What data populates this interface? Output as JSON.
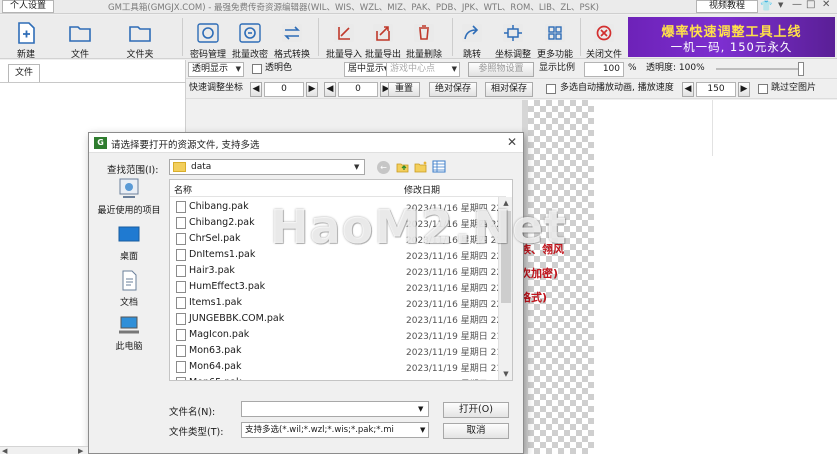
{
  "titlebar": {
    "personal_settings": "个人设置",
    "app_title": "GM工具箱(GMGJX.COM) - 最强免费传奇资源编辑器(WIL、WIS、WZL、MIZ、PAK、PDB、JPK、WTL、ROM、LIB、ZL、PSK)",
    "video_tutorial": "视频教程",
    "minimize": "—",
    "maximize": "□",
    "close": "✕"
  },
  "toolbar": {
    "new": "新建",
    "file": "文件",
    "folder": "文件夹",
    "password_mgmt": "密码管理",
    "batch_password": "批量改密",
    "format_convert": "格式转换",
    "batch_import": "批量导入",
    "batch_export": "批量导出",
    "batch_delete": "批量删除",
    "jump": "跳转",
    "coord_adjust": "坐标调整",
    "more": "更多功能",
    "close_file": "关闭文件"
  },
  "banner": {
    "line1": "爆率快速调整工具上线",
    "line2": "一机一码, 150元永久"
  },
  "left_panel": {
    "tab_file": "文件"
  },
  "options_row1": {
    "transparency_mode": "透明显示",
    "transparent_color": "透明色",
    "center_display": "居中显示",
    "center_point": "游戏中心点",
    "reference_setting": "参照物设置",
    "display_ratio_label": "显示比例",
    "display_ratio_value": "100",
    "percent": "%",
    "opacity_label": "透明度: 100%",
    "opacity_value": 1.0
  },
  "options_row2": {
    "quick_coord_label": "快速调整坐标",
    "x_value": "0",
    "y_value": "0",
    "reset": "重置",
    "absolute_save": "绝对保存",
    "relative_save": "相对保存",
    "multi_select_autoplay": "多选自动播放动画, 播放速度",
    "speed_value": "150",
    "skip_empty": "跳过空图片"
  },
  "background_text": {
    "line1": "族、翎风",
    "line2": "次加密)",
    "line3": "格式)"
  },
  "watermark": "HaoM2.Net",
  "dialog": {
    "title": "请选择要打开的资源文件, 支持多选",
    "look_in_label": "查找范围(I):",
    "look_in_value": "data",
    "places": [
      "最近使用的项目",
      "桌面",
      "文档",
      "此电脑"
    ],
    "columns": {
      "name": "名称",
      "date": "修改日期"
    },
    "files": [
      {
        "name": "Chibang.pak",
        "date": "2023/11/16 星期四 22"
      },
      {
        "name": "Chibang2.pak",
        "date": "2023/11/16 星期四 22"
      },
      {
        "name": "ChrSel.pak",
        "date": "2023/11/16 星期四 22"
      },
      {
        "name": "DnItems1.pak",
        "date": "2023/11/16 星期四 22"
      },
      {
        "name": "Hair3.pak",
        "date": "2023/11/16 星期四 22"
      },
      {
        "name": "HumEffect3.pak",
        "date": "2023/11/16 星期四 22"
      },
      {
        "name": "Items1.pak",
        "date": "2023/11/16 星期四 22"
      },
      {
        "name": "JUNGEBBK.COM.pak",
        "date": "2023/11/16 星期四 22"
      },
      {
        "name": "MagIcon.pak",
        "date": "2023/11/19 星期日 21"
      },
      {
        "name": "Mon63.pak",
        "date": "2023/11/19 星期日 21"
      },
      {
        "name": "Mon64.pak",
        "date": "2023/11/19 星期日 21"
      },
      {
        "name": "Mon65.pak",
        "date": "2023/11/19 星期日 21"
      }
    ],
    "filename_label": "文件名(N):",
    "filename_value": "",
    "filetype_label": "文件类型(T):",
    "filetype_value": "支持多选(*.wil;*.wzl;*.wis;*.pak;*.mi",
    "open_button": "打开(O)",
    "cancel_button": "取消"
  },
  "colors": {
    "banner_bg": "#6d22b8",
    "banner_text": "#ffe04a",
    "close_icon": "#d32f2f",
    "accent_blue": "#2e6db7",
    "red_text": "#c0141c"
  }
}
